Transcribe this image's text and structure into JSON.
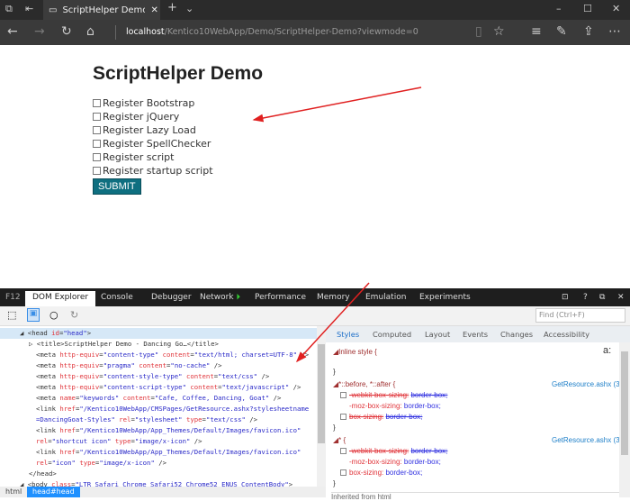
{
  "browser": {
    "tab_title": "ScriptHelper Demo - Da",
    "url_host": "localhost",
    "url_path": "/Kentico10WebApp/Demo/ScriptHelper-Demo?viewmode=0"
  },
  "page": {
    "title": "ScriptHelper Demo",
    "checkboxes": [
      "Register Bootstrap",
      "Register jQuery",
      "Register Lazy Load",
      "Register SpellChecker",
      "Register script",
      "Register startup script"
    ],
    "submit": "SUBMIT",
    "submit_color": "#0e6f80"
  },
  "devtools": {
    "f12": "F12",
    "tabs": [
      "DOM Explorer",
      "Console",
      "Debugger",
      "Network",
      "Performance",
      "Memory",
      "Emulation",
      "Experiments"
    ],
    "find_placeholder": "Find (Ctrl+F)",
    "dom_lines": [
      [
        {
          "t": "◢ ",
          "k": "text"
        },
        {
          "t": "<head ",
          "k": "tag"
        },
        {
          "t": "id",
          "k": "attr"
        },
        {
          "t": "=",
          "k": "tag"
        },
        {
          "t": "\"head\"",
          "k": "val"
        },
        {
          "t": ">",
          "k": "tag"
        }
      ],
      [
        {
          "t": "▷ <title>ScriptHelper Demo - Dancing Go…</title>",
          "k": "tag"
        }
      ],
      [
        {
          "t": "<meta ",
          "k": "tag"
        },
        {
          "t": "http-equiv",
          "k": "attr"
        },
        {
          "t": "=",
          "k": "tag"
        },
        {
          "t": "\"content-type\"",
          "k": "val"
        },
        {
          "t": " content",
          "k": "attr"
        },
        {
          "t": "=",
          "k": "tag"
        },
        {
          "t": "\"text/html; charset=UTF-8\"",
          "k": "val"
        },
        {
          "t": " />",
          "k": "tag"
        }
      ],
      [
        {
          "t": "<meta ",
          "k": "tag"
        },
        {
          "t": "http-equiv",
          "k": "attr"
        },
        {
          "t": "=",
          "k": "tag"
        },
        {
          "t": "\"pragma\"",
          "k": "val"
        },
        {
          "t": " content",
          "k": "attr"
        },
        {
          "t": "=",
          "k": "tag"
        },
        {
          "t": "\"no-cache\"",
          "k": "val"
        },
        {
          "t": " />",
          "k": "tag"
        }
      ],
      [
        {
          "t": "<meta ",
          "k": "tag"
        },
        {
          "t": "http-equiv",
          "k": "attr"
        },
        {
          "t": "=",
          "k": "tag"
        },
        {
          "t": "\"content-style-type\"",
          "k": "val"
        },
        {
          "t": " content",
          "k": "attr"
        },
        {
          "t": "=",
          "k": "tag"
        },
        {
          "t": "\"text/css\"",
          "k": "val"
        },
        {
          "t": " />",
          "k": "tag"
        }
      ],
      [
        {
          "t": "<meta ",
          "k": "tag"
        },
        {
          "t": "http-equiv",
          "k": "attr"
        },
        {
          "t": "=",
          "k": "tag"
        },
        {
          "t": "\"content-script-type\"",
          "k": "val"
        },
        {
          "t": " content",
          "k": "attr"
        },
        {
          "t": "=",
          "k": "tag"
        },
        {
          "t": "\"text/javascript\"",
          "k": "val"
        },
        {
          "t": " />",
          "k": "tag"
        }
      ],
      [
        {
          "t": "<meta ",
          "k": "tag"
        },
        {
          "t": "name",
          "k": "attr"
        },
        {
          "t": "=",
          "k": "tag"
        },
        {
          "t": "\"keywords\"",
          "k": "val"
        },
        {
          "t": " content",
          "k": "attr"
        },
        {
          "t": "=",
          "k": "tag"
        },
        {
          "t": "\"Cafe, Coffee, Dancing, Goat\"",
          "k": "val"
        },
        {
          "t": " />",
          "k": "tag"
        }
      ],
      [
        {
          "t": "<link ",
          "k": "tag"
        },
        {
          "t": "href",
          "k": "attr"
        },
        {
          "t": "=",
          "k": "tag"
        },
        {
          "t": "\"/Kentico10WebApp/CMSPages/GetResource.ashx?stylesheetname",
          "k": "val"
        }
      ],
      [
        {
          "t": "=DancingGoat-Styles\"",
          "k": "val"
        },
        {
          "t": " rel",
          "k": "attr"
        },
        {
          "t": "=",
          "k": "tag"
        },
        {
          "t": "\"stylesheet\"",
          "k": "val"
        },
        {
          "t": " type",
          "k": "attr"
        },
        {
          "t": "=",
          "k": "tag"
        },
        {
          "t": "\"text/css\"",
          "k": "val"
        },
        {
          "t": " />",
          "k": "tag"
        }
      ],
      [
        {
          "t": "<link ",
          "k": "tag"
        },
        {
          "t": "href",
          "k": "attr"
        },
        {
          "t": "=",
          "k": "tag"
        },
        {
          "t": "\"/Kentico10WebApp/App_Themes/Default/Images/favicon.ico\"",
          "k": "val"
        }
      ],
      [
        {
          "t": "rel",
          "k": "attr"
        },
        {
          "t": "=",
          "k": "tag"
        },
        {
          "t": "\"shortcut icon\"",
          "k": "val"
        },
        {
          "t": " type",
          "k": "attr"
        },
        {
          "t": "=",
          "k": "tag"
        },
        {
          "t": "\"image/x-icon\"",
          "k": "val"
        },
        {
          "t": " />",
          "k": "tag"
        }
      ],
      [
        {
          "t": "<link ",
          "k": "tag"
        },
        {
          "t": "href",
          "k": "attr"
        },
        {
          "t": "=",
          "k": "tag"
        },
        {
          "t": "\"/Kentico10WebApp/App_Themes/Default/Images/favicon.ico\"",
          "k": "val"
        }
      ],
      [
        {
          "t": "rel",
          "k": "attr"
        },
        {
          "t": "=",
          "k": "tag"
        },
        {
          "t": "\"icon\"",
          "k": "val"
        },
        {
          "t": " type",
          "k": "attr"
        },
        {
          "t": "=",
          "k": "tag"
        },
        {
          "t": "\"image/x-icon\"",
          "k": "val"
        },
        {
          "t": " />",
          "k": "tag"
        }
      ],
      [
        {
          "t": "</head>",
          "k": "tag"
        }
      ],
      [
        {
          "t": "◢ <body ",
          "k": "tag"
        },
        {
          "t": "class",
          "k": "attr"
        },
        {
          "t": "=",
          "k": "tag"
        },
        {
          "t": "\"LTR Safari Chrome Safari52 Chrome52 ENUS ContentBody\"",
          "k": "val"
        },
        {
          "t": ">",
          "k": "tag"
        }
      ]
    ],
    "breadcrumb": [
      "html",
      "head#head"
    ],
    "style_tabs": [
      "Styles",
      "Computed",
      "Layout",
      "Events",
      "Changes",
      "Accessibility"
    ],
    "styles": {
      "inline": "Inline style  {",
      "close": "}",
      "rule1_sel": "*::before, *::after  {",
      "rule2_sel": "*  {",
      "source": "GetResource.ashx (3)",
      "p_webkit": "-webkit-box-sizing:",
      "p_moz": "-moz-box-sizing:",
      "p_box": "box-sizing:",
      "v": "border-box;",
      "a_icon": "a:",
      "inherited": "Inherited from html"
    }
  }
}
